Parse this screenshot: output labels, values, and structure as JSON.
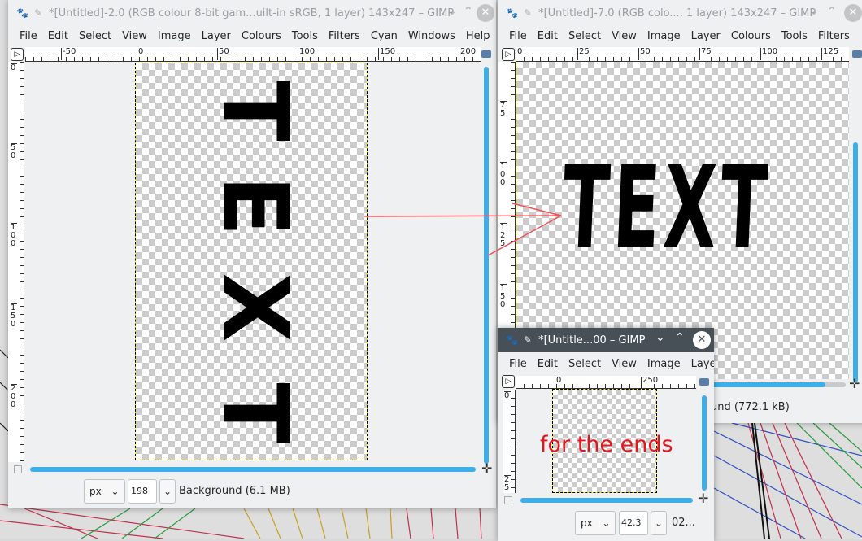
{
  "windows": [
    {
      "title": "*[Untitled]-2.0 (RGB colour 8-bit gam...uilt-in sRGB, 1 layer) 143x247 – GIMP",
      "menu": [
        "File",
        "Edit",
        "Select",
        "View",
        "Image",
        "Layer",
        "Colours",
        "Tools",
        "Filters",
        "Cyan",
        "Windows",
        "Help"
      ],
      "hruler": [
        "-50",
        "0",
        "50",
        "100",
        "150",
        "200"
      ],
      "vruler": [
        "0",
        "50",
        "100",
        "150",
        "200"
      ],
      "canvas_letters": [
        "T",
        "E",
        "X",
        "T"
      ],
      "unit": "px",
      "zoom": "198 %",
      "status": "Background (6.1 MB)"
    },
    {
      "title": "*[Untitled]-7.0 (RGB colo..., 1 layer) 143x247 – GIMP",
      "menu": [
        "File",
        "Edit",
        "Select",
        "View",
        "Image",
        "Layer",
        "Colours",
        "Tools",
        "Filters"
      ],
      "hruler": [
        "0",
        "25",
        "50",
        "75",
        "100",
        "125"
      ],
      "vruler": [
        "75",
        "100",
        "125",
        "150"
      ],
      "canvas_text": "TEXT",
      "status": "und (772.1 kB)"
    },
    {
      "title": "*[Untitle...00 – GIMP",
      "menu": [
        "File",
        "Edit",
        "Select",
        "View",
        "Image",
        "Laye"
      ],
      "hruler": [
        "0",
        "250"
      ],
      "vruler": [
        "0",
        "25"
      ],
      "annotation": "for the ends",
      "unit": "px",
      "zoom": "42.3 %",
      "status": "02..."
    }
  ],
  "colors": {
    "accent": "#3daee9",
    "annotation": "#e8141c",
    "arrow": "#f0505a",
    "active_titlebar": "#475057"
  }
}
